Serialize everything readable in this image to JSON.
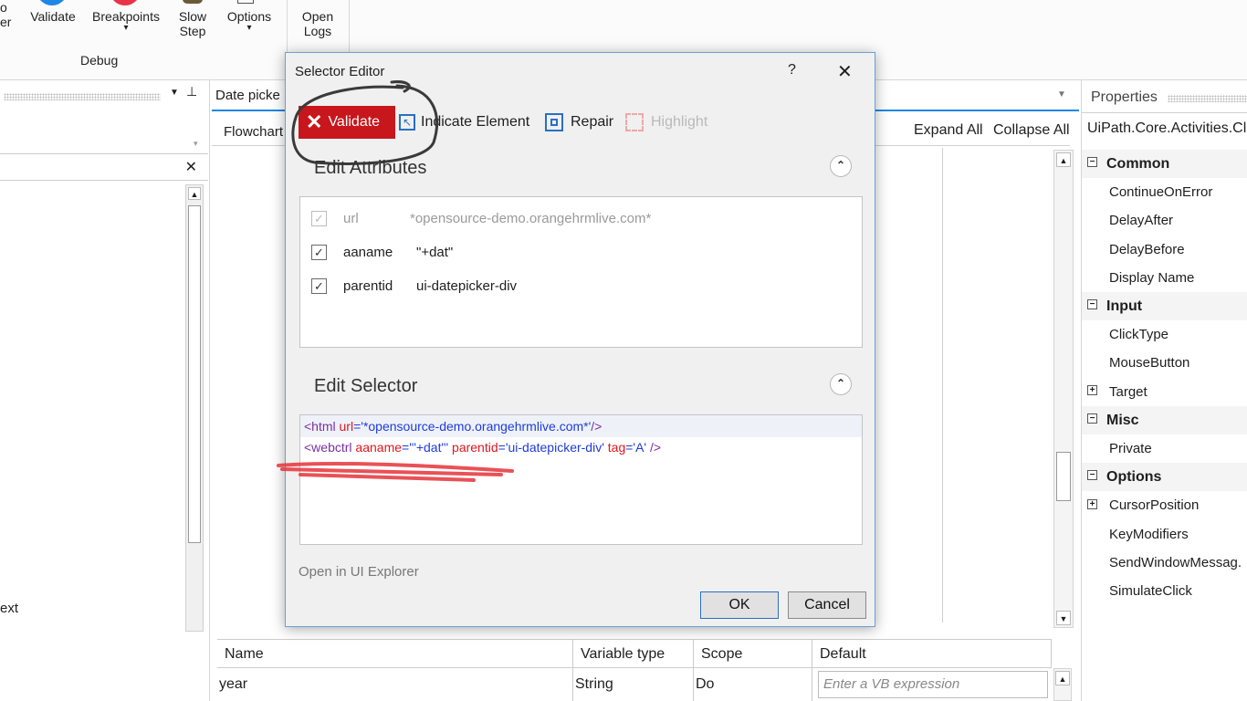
{
  "ribbon": {
    "buttons": [
      {
        "id": "prev",
        "label_line1": "o",
        "label_line2": "er"
      },
      {
        "id": "validate",
        "label": "Validate"
      },
      {
        "id": "breakpoints",
        "label": "Breakpoints",
        "arrow": "▾"
      },
      {
        "id": "slowstep",
        "label_line1": "Slow",
        "label_line2": "Step"
      },
      {
        "id": "options",
        "label": "Options",
        "arrow": "▾"
      },
      {
        "id": "openlogs",
        "label_line1": "Open",
        "label_line2": "Logs"
      }
    ],
    "group_label": "Debug"
  },
  "left_panel": {
    "pin_icon": "ᵖ",
    "close_label": "✕",
    "partial_text": "ext"
  },
  "designer": {
    "tab_label": "Date picke",
    "breadcrumb": "Flowchart",
    "expand_all": "Expand All",
    "collapse_all": "Collapse All"
  },
  "properties": {
    "title": "Properties",
    "type_name": "UiPath.Core.Activities.Clic",
    "rows": [
      {
        "kind": "cat",
        "label": "Common",
        "sign": "⊟"
      },
      {
        "kind": "prop",
        "label": "ContinueOnError"
      },
      {
        "kind": "prop",
        "label": "DelayAfter"
      },
      {
        "kind": "prop",
        "label": "DelayBefore"
      },
      {
        "kind": "prop",
        "label": "Display Name"
      },
      {
        "kind": "cat",
        "label": "Input",
        "sign": "⊟"
      },
      {
        "kind": "prop",
        "label": "ClickType"
      },
      {
        "kind": "prop",
        "label": "MouseButton"
      },
      {
        "kind": "expprop",
        "label": "Target",
        "sign": "⊞"
      },
      {
        "kind": "cat",
        "label": "Misc",
        "sign": "⊟"
      },
      {
        "kind": "prop",
        "label": "Private"
      },
      {
        "kind": "cat",
        "label": "Options",
        "sign": "⊟"
      },
      {
        "kind": "expprop",
        "label": "CursorPosition",
        "sign": "⊞"
      },
      {
        "kind": "prop",
        "label": "KeyModifiers"
      },
      {
        "kind": "prop",
        "label": "SendWindowMessag."
      },
      {
        "kind": "prop",
        "label": "SimulateClick"
      }
    ]
  },
  "dialog": {
    "title": "Selector Editor",
    "help": "?",
    "close": "✕",
    "toolbar": {
      "validate": "Validate",
      "indicate": "Indicate Element",
      "repair": "Repair",
      "highlight": "Highlight"
    },
    "edit_attributes_title": "Edit Attributes",
    "attributes": [
      {
        "name": "url",
        "value": "*opensource-demo.orangehrmlive.com*",
        "checked": true,
        "disabled": true
      },
      {
        "name": "aaname",
        "value": "\"+dat\"",
        "checked": true,
        "disabled": false
      },
      {
        "name": "parentid",
        "value": "ui-datepicker-div",
        "checked": true,
        "disabled": false
      }
    ],
    "edit_selector_title": "Edit Selector",
    "selector_line1": {
      "open": "<html ",
      "attr": "url",
      "eq": "=",
      "val": "'*opensource-demo.orangehrmlive.com*'",
      "close": "/>"
    },
    "selector_line2": {
      "open": "<webctrl ",
      "a1": "aaname",
      "eq1": "=",
      "v1": "'\"+dat\"'",
      "a2": " parentid",
      "eq2": "=",
      "v2": "'ui-datepicker-div'",
      "a3": " tag",
      "eq3": "=",
      "v3": "'A'",
      "close": " />"
    },
    "open_in_explorer": "Open in UI Explorer",
    "ok": "OK",
    "cancel": "Cancel"
  },
  "variables": {
    "headers": [
      "Name",
      "Variable type",
      "Scope",
      "Default"
    ],
    "rows": [
      {
        "name": "year",
        "type": "String",
        "scope": "Do",
        "default_placeholder": "Enter a VB expression"
      }
    ]
  },
  "colors": {
    "validate_red": "#c8161d",
    "dialog_border": "#6aa0d8",
    "selector_tag": "#7b2fa5",
    "selector_attr": "#e0161d",
    "selector_value": "#1f3bd9"
  }
}
